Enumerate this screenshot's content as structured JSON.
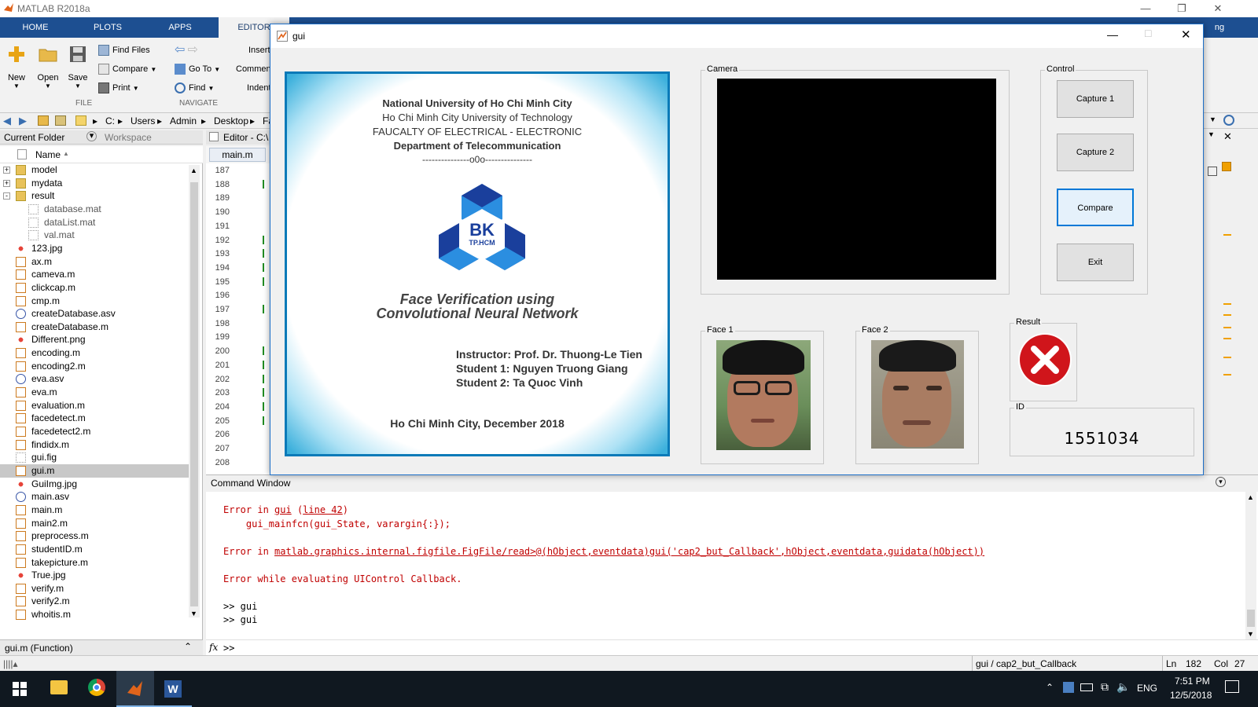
{
  "matlab": {
    "title": "MATLAB R2018a",
    "tabs": [
      "HOME",
      "PLOTS",
      "APPS",
      "EDITOR"
    ],
    "ribbon": {
      "new": "New",
      "open": "Open",
      "save": "Save",
      "find_files": "Find Files",
      "compare": "Compare",
      "print": "Print",
      "goto": "Go To",
      "find": "Find",
      "insert": "Insert",
      "comment": "Comment",
      "indent": "Indent",
      "group_file": "FILE",
      "group_navigate": "NAVIGATE",
      "right_clip": "ng"
    },
    "address": [
      "C:",
      "Users",
      "Admin",
      "Desktop",
      "Fa"
    ],
    "current_folder_title": "Current Folder",
    "workspace_title": "Workspace",
    "name_header": "Name",
    "files": [
      {
        "name": "model",
        "type": "folder",
        "expand": "+"
      },
      {
        "name": "mydata",
        "type": "folder",
        "expand": "+"
      },
      {
        "name": "result",
        "type": "folder",
        "expand": "-"
      },
      {
        "name": "database.mat",
        "type": "mat",
        "child": true
      },
      {
        "name": "dataList.mat",
        "type": "mat",
        "child": true
      },
      {
        "name": "val.mat",
        "type": "mat",
        "child": true
      },
      {
        "name": "123.jpg",
        "type": "img"
      },
      {
        "name": "ax.m",
        "type": "m"
      },
      {
        "name": "cameva.m",
        "type": "m"
      },
      {
        "name": "clickcap.m",
        "type": "m"
      },
      {
        "name": "cmp.m",
        "type": "m"
      },
      {
        "name": "createDatabase.asv",
        "type": "asv"
      },
      {
        "name": "createDatabase.m",
        "type": "m"
      },
      {
        "name": "Different.png",
        "type": "img"
      },
      {
        "name": "encoding.m",
        "type": "m"
      },
      {
        "name": "encoding2.m",
        "type": "m"
      },
      {
        "name": "eva.asv",
        "type": "asv"
      },
      {
        "name": "eva.m",
        "type": "m"
      },
      {
        "name": "evaluation.m",
        "type": "m"
      },
      {
        "name": "facedetect.m",
        "type": "m"
      },
      {
        "name": "facedetect2.m",
        "type": "m"
      },
      {
        "name": "findidx.m",
        "type": "m"
      },
      {
        "name": "gui.fig",
        "type": "fig"
      },
      {
        "name": "gui.m",
        "type": "m",
        "selected": true
      },
      {
        "name": "GuiImg.jpg",
        "type": "img"
      },
      {
        "name": "main.asv",
        "type": "asv"
      },
      {
        "name": "main.m",
        "type": "m"
      },
      {
        "name": "main2.m",
        "type": "m"
      },
      {
        "name": "preprocess.m",
        "type": "m"
      },
      {
        "name": "studentID.m",
        "type": "m"
      },
      {
        "name": "takepicture.m",
        "type": "m"
      },
      {
        "name": "True.jpg",
        "type": "img"
      },
      {
        "name": "verify.m",
        "type": "m"
      },
      {
        "name": "verify2.m",
        "type": "m"
      },
      {
        "name": "whoitis.m",
        "type": "m"
      }
    ],
    "folder_status": "gui.m  (Function)",
    "editor_title": "Editor - C:\\",
    "editor_tab": "main.m",
    "line_numbers": [
      "187",
      "188",
      "189",
      "190",
      "191",
      "192",
      "193",
      "194",
      "195",
      "196",
      "197",
      "198",
      "199",
      "200",
      "201",
      "202",
      "203",
      "204",
      "205",
      "206",
      "207",
      "208"
    ],
    "command_window_title": "Command Window",
    "cmd_lines": [
      {
        "kind": "err",
        "parts": [
          [
            "Error in ",
            "e"
          ],
          [
            "gui",
            "l"
          ],
          [
            " (",
            "e"
          ],
          [
            "line 42",
            "l"
          ],
          [
            ")",
            "e"
          ]
        ]
      },
      {
        "kind": "err",
        "parts": [
          [
            "    gui_mainfcn(gui_State, varargin{:});",
            "e"
          ]
        ]
      },
      {
        "kind": "blank",
        "parts": []
      },
      {
        "kind": "err",
        "parts": [
          [
            "Error in ",
            "e"
          ],
          [
            "matlab.graphics.internal.figfile.FigFile/read>@(hObject,eventdata)gui('cap2_but_Callback',hObject,eventdata,guidata(hObject))",
            "l"
          ]
        ]
      },
      {
        "kind": "blank",
        "parts": []
      },
      {
        "kind": "err",
        "parts": [
          [
            "Error while evaluating UIControl Callback.",
            "e"
          ]
        ]
      },
      {
        "kind": "blank",
        "parts": []
      },
      {
        "kind": "norm",
        "parts": [
          [
            ">> gui",
            "n"
          ]
        ]
      },
      {
        "kind": "norm",
        "parts": [
          [
            ">> gui",
            "n"
          ]
        ]
      }
    ],
    "prompt": ">>",
    "fx": "fx",
    "status_func": "gui / cap2_but_Callback",
    "status_ln_label": "Ln",
    "status_ln": "182",
    "status_col_label": "Col",
    "status_col": "27"
  },
  "gui": {
    "title": "gui",
    "camera_label": "Camera",
    "control_label": "Control",
    "buttons": [
      "Capture 1",
      "Capture 2",
      "Compare",
      "Exit"
    ],
    "face1_label": "Face 1",
    "face2_label": "Face 2",
    "result_label": "Result",
    "id_label": "ID",
    "id_value": "1551034",
    "poster": {
      "line1": "National University of Ho Chi Minh City",
      "line2": "Ho Chi Minh City University of Technology",
      "line3": "FAUCALTY OF ELECTRICAL - ELECTRONIC",
      "line4": "Department of Telecommunication",
      "line5": "---------------o0o---------------",
      "logo_text": "BK",
      "logo_sub": "TP.HCM",
      "title1": "Face Verification using",
      "title2": "Convolutional Neural Network",
      "instructor": "Instructor: Prof. Dr. Thuong-Le Tien",
      "student1": "Student 1: Nguyen Truong Giang",
      "student2": "Student 2: Ta Quoc Vinh",
      "footer": "Ho Chi Minh City, December 2018"
    }
  },
  "taskbar": {
    "lang": "ENG",
    "time": "7:51 PM",
    "date": "12/5/2018"
  },
  "colors": {
    "ribbon_tab": "#1d4f91",
    "error": "#c00000",
    "poster_border": "#0a7ab8",
    "logo_dark": "#1a3f9c",
    "logo_light": "#2b8ee0",
    "result_red": "#d0151b"
  }
}
